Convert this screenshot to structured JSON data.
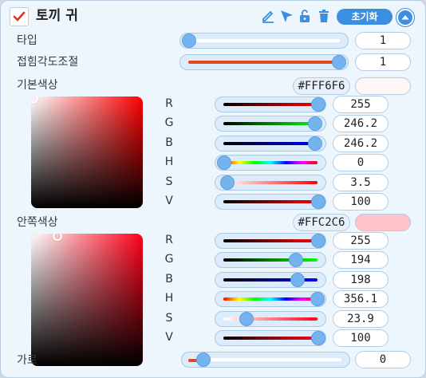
{
  "header": {
    "title": "토끼 귀",
    "checked": true,
    "icons": [
      "pen-icon",
      "cursor-icon",
      "lock-open-icon",
      "trash-icon"
    ],
    "reset_label": "초기화",
    "collapse_icon": "chevron-up-icon"
  },
  "type_row": {
    "label": "타입",
    "value": "1",
    "fraction": 0.0
  },
  "fold_row": {
    "label": "접힘각도조절",
    "value": "1",
    "fraction": 1.0
  },
  "base_color": {
    "label": "기본색상",
    "hex": "#FFF6F6",
    "swatch": "#FFF6F6",
    "hue_color": "#FF0000",
    "channels": [
      {
        "name": "R",
        "value": "255",
        "fraction": 1.0
      },
      {
        "name": "G",
        "value": "246.2",
        "fraction": 0.965
      },
      {
        "name": "B",
        "value": "246.2",
        "fraction": 0.965
      },
      {
        "name": "H",
        "value": "0",
        "fraction": 0.0
      },
      {
        "name": "S",
        "value": "3.5",
        "fraction": 0.035
      },
      {
        "name": "V",
        "value": "100",
        "fraction": 1.0
      }
    ]
  },
  "inner_color": {
    "label": "안쪽색상",
    "hex": "#FFC2C6",
    "swatch": "#FFC2C6",
    "hue_color": "#FF0018",
    "channels": [
      {
        "name": "R",
        "value": "255",
        "fraction": 1.0
      },
      {
        "name": "G",
        "value": "194",
        "fraction": 0.761
      },
      {
        "name": "B",
        "value": "198",
        "fraction": 0.776
      },
      {
        "name": "H",
        "value": "356.1",
        "fraction": 0.989
      },
      {
        "name": "S",
        "value": "23.9",
        "fraction": 0.239
      },
      {
        "name": "V",
        "value": "100",
        "fraction": 1.0
      }
    ]
  },
  "width_row": {
    "label": "가로",
    "value": "0",
    "fraction": 0.0
  },
  "colors": {
    "accent": "#3C8FE0",
    "thumb": "#74B3EE",
    "panel": "#EDF5FD"
  }
}
